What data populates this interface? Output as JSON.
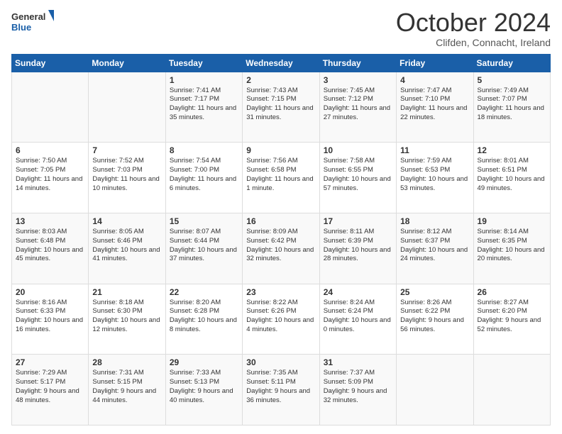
{
  "logo": {
    "general": "General",
    "blue": "Blue"
  },
  "header": {
    "month": "October 2024",
    "location": "Clifden, Connacht, Ireland"
  },
  "days_of_week": [
    "Sunday",
    "Monday",
    "Tuesday",
    "Wednesday",
    "Thursday",
    "Friday",
    "Saturday"
  ],
  "weeks": [
    [
      {
        "num": "",
        "sunrise": "",
        "sunset": "",
        "daylight": ""
      },
      {
        "num": "",
        "sunrise": "",
        "sunset": "",
        "daylight": ""
      },
      {
        "num": "1",
        "sunrise": "Sunrise: 7:41 AM",
        "sunset": "Sunset: 7:17 PM",
        "daylight": "Daylight: 11 hours and 35 minutes."
      },
      {
        "num": "2",
        "sunrise": "Sunrise: 7:43 AM",
        "sunset": "Sunset: 7:15 PM",
        "daylight": "Daylight: 11 hours and 31 minutes."
      },
      {
        "num": "3",
        "sunrise": "Sunrise: 7:45 AM",
        "sunset": "Sunset: 7:12 PM",
        "daylight": "Daylight: 11 hours and 27 minutes."
      },
      {
        "num": "4",
        "sunrise": "Sunrise: 7:47 AM",
        "sunset": "Sunset: 7:10 PM",
        "daylight": "Daylight: 11 hours and 22 minutes."
      },
      {
        "num": "5",
        "sunrise": "Sunrise: 7:49 AM",
        "sunset": "Sunset: 7:07 PM",
        "daylight": "Daylight: 11 hours and 18 minutes."
      }
    ],
    [
      {
        "num": "6",
        "sunrise": "Sunrise: 7:50 AM",
        "sunset": "Sunset: 7:05 PM",
        "daylight": "Daylight: 11 hours and 14 minutes."
      },
      {
        "num": "7",
        "sunrise": "Sunrise: 7:52 AM",
        "sunset": "Sunset: 7:03 PM",
        "daylight": "Daylight: 11 hours and 10 minutes."
      },
      {
        "num": "8",
        "sunrise": "Sunrise: 7:54 AM",
        "sunset": "Sunset: 7:00 PM",
        "daylight": "Daylight: 11 hours and 6 minutes."
      },
      {
        "num": "9",
        "sunrise": "Sunrise: 7:56 AM",
        "sunset": "Sunset: 6:58 PM",
        "daylight": "Daylight: 11 hours and 1 minute."
      },
      {
        "num": "10",
        "sunrise": "Sunrise: 7:58 AM",
        "sunset": "Sunset: 6:55 PM",
        "daylight": "Daylight: 10 hours and 57 minutes."
      },
      {
        "num": "11",
        "sunrise": "Sunrise: 7:59 AM",
        "sunset": "Sunset: 6:53 PM",
        "daylight": "Daylight: 10 hours and 53 minutes."
      },
      {
        "num": "12",
        "sunrise": "Sunrise: 8:01 AM",
        "sunset": "Sunset: 6:51 PM",
        "daylight": "Daylight: 10 hours and 49 minutes."
      }
    ],
    [
      {
        "num": "13",
        "sunrise": "Sunrise: 8:03 AM",
        "sunset": "Sunset: 6:48 PM",
        "daylight": "Daylight: 10 hours and 45 minutes."
      },
      {
        "num": "14",
        "sunrise": "Sunrise: 8:05 AM",
        "sunset": "Sunset: 6:46 PM",
        "daylight": "Daylight: 10 hours and 41 minutes."
      },
      {
        "num": "15",
        "sunrise": "Sunrise: 8:07 AM",
        "sunset": "Sunset: 6:44 PM",
        "daylight": "Daylight: 10 hours and 37 minutes."
      },
      {
        "num": "16",
        "sunrise": "Sunrise: 8:09 AM",
        "sunset": "Sunset: 6:42 PM",
        "daylight": "Daylight: 10 hours and 32 minutes."
      },
      {
        "num": "17",
        "sunrise": "Sunrise: 8:11 AM",
        "sunset": "Sunset: 6:39 PM",
        "daylight": "Daylight: 10 hours and 28 minutes."
      },
      {
        "num": "18",
        "sunrise": "Sunrise: 8:12 AM",
        "sunset": "Sunset: 6:37 PM",
        "daylight": "Daylight: 10 hours and 24 minutes."
      },
      {
        "num": "19",
        "sunrise": "Sunrise: 8:14 AM",
        "sunset": "Sunset: 6:35 PM",
        "daylight": "Daylight: 10 hours and 20 minutes."
      }
    ],
    [
      {
        "num": "20",
        "sunrise": "Sunrise: 8:16 AM",
        "sunset": "Sunset: 6:33 PM",
        "daylight": "Daylight: 10 hours and 16 minutes."
      },
      {
        "num": "21",
        "sunrise": "Sunrise: 8:18 AM",
        "sunset": "Sunset: 6:30 PM",
        "daylight": "Daylight: 10 hours and 12 minutes."
      },
      {
        "num": "22",
        "sunrise": "Sunrise: 8:20 AM",
        "sunset": "Sunset: 6:28 PM",
        "daylight": "Daylight: 10 hours and 8 minutes."
      },
      {
        "num": "23",
        "sunrise": "Sunrise: 8:22 AM",
        "sunset": "Sunset: 6:26 PM",
        "daylight": "Daylight: 10 hours and 4 minutes."
      },
      {
        "num": "24",
        "sunrise": "Sunrise: 8:24 AM",
        "sunset": "Sunset: 6:24 PM",
        "daylight": "Daylight: 10 hours and 0 minutes."
      },
      {
        "num": "25",
        "sunrise": "Sunrise: 8:26 AM",
        "sunset": "Sunset: 6:22 PM",
        "daylight": "Daylight: 9 hours and 56 minutes."
      },
      {
        "num": "26",
        "sunrise": "Sunrise: 8:27 AM",
        "sunset": "Sunset: 6:20 PM",
        "daylight": "Daylight: 9 hours and 52 minutes."
      }
    ],
    [
      {
        "num": "27",
        "sunrise": "Sunrise: 7:29 AM",
        "sunset": "Sunset: 5:17 PM",
        "daylight": "Daylight: 9 hours and 48 minutes."
      },
      {
        "num": "28",
        "sunrise": "Sunrise: 7:31 AM",
        "sunset": "Sunset: 5:15 PM",
        "daylight": "Daylight: 9 hours and 44 minutes."
      },
      {
        "num": "29",
        "sunrise": "Sunrise: 7:33 AM",
        "sunset": "Sunset: 5:13 PM",
        "daylight": "Daylight: 9 hours and 40 minutes."
      },
      {
        "num": "30",
        "sunrise": "Sunrise: 7:35 AM",
        "sunset": "Sunset: 5:11 PM",
        "daylight": "Daylight: 9 hours and 36 minutes."
      },
      {
        "num": "31",
        "sunrise": "Sunrise: 7:37 AM",
        "sunset": "Sunset: 5:09 PM",
        "daylight": "Daylight: 9 hours and 32 minutes."
      },
      {
        "num": "",
        "sunrise": "",
        "sunset": "",
        "daylight": ""
      },
      {
        "num": "",
        "sunrise": "",
        "sunset": "",
        "daylight": ""
      }
    ]
  ]
}
